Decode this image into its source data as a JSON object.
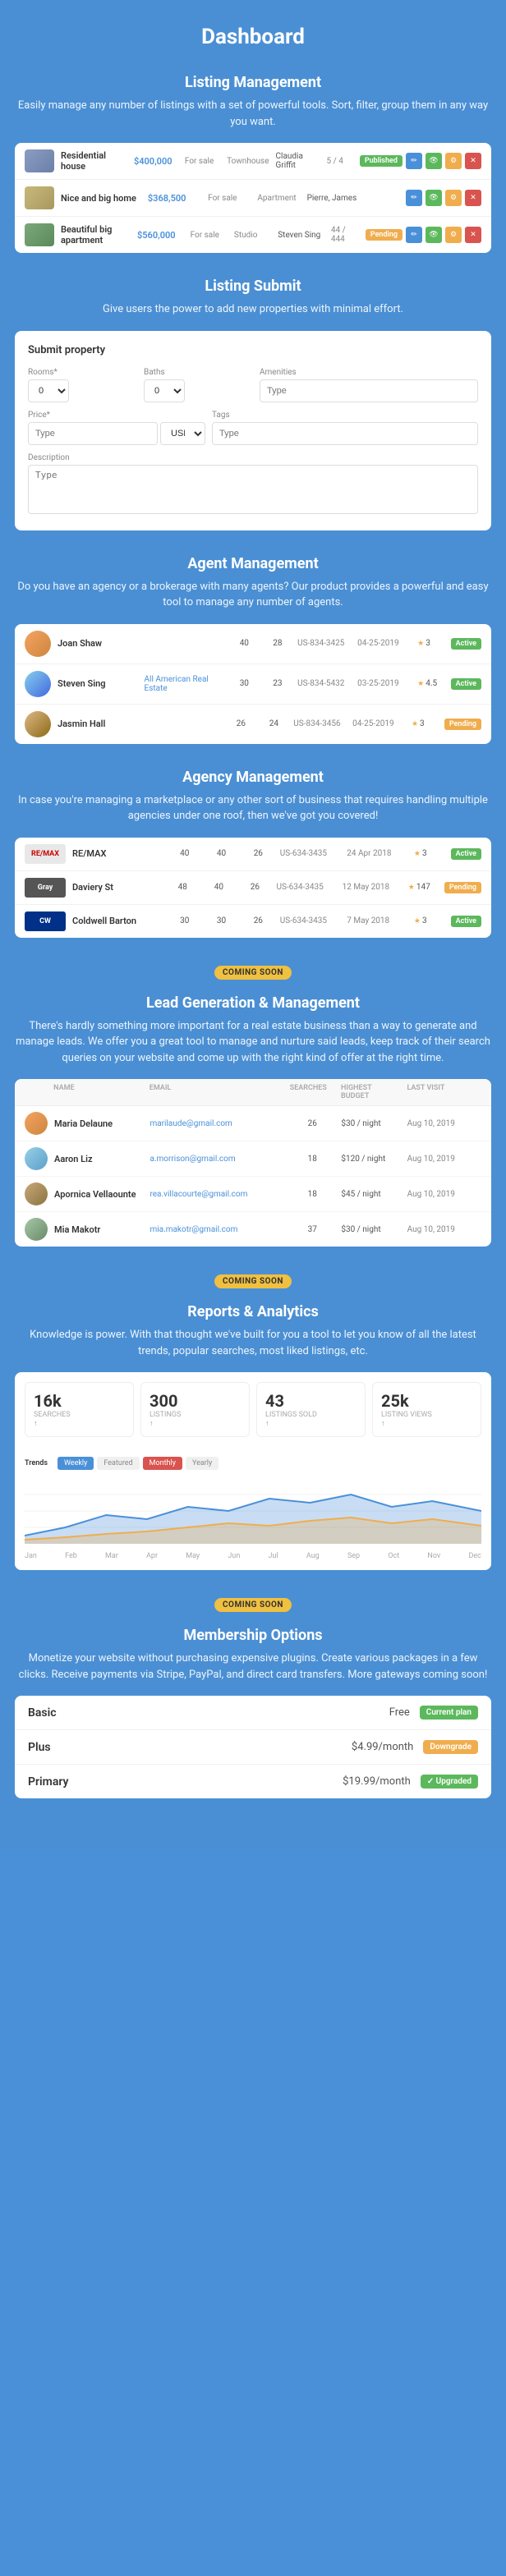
{
  "page": {
    "title": "Dashboard"
  },
  "listing_management": {
    "title": "Listing Management",
    "description": "Easily manage any number of listings with a set of powerful tools. Sort, filter, group them in any way you want.",
    "listings": [
      {
        "name": "Residential house",
        "price": "$400,000",
        "status": "For sale",
        "type": "Townhouse",
        "agent": "Claudia Griffit",
        "beds": "5",
        "baths": "4",
        "badge": "Published",
        "badge_type": "success",
        "thumb_class": "residential"
      },
      {
        "name": "Nice and big home",
        "price": "$368,500",
        "status": "For sale",
        "type": "Apartment",
        "agent": "Pierre, James",
        "beds": "",
        "baths": "",
        "badge": "",
        "badge_type": "",
        "thumb_class": "modern"
      },
      {
        "name": "Beautiful big apartment",
        "price": "$560,000",
        "status": "For sale",
        "type": "Studio",
        "agent": "Steven Sing",
        "beds": "44",
        "baths": "444",
        "badge": "Pending",
        "badge_type": "warning",
        "thumb_class": "apt"
      }
    ]
  },
  "listing_submit": {
    "title": "Listing Submit",
    "description": "Give users the power to add new properties with minimal effort.",
    "form_title": "Submit property",
    "fields": {
      "rooms_label": "Rooms*",
      "rooms_placeholder": "0",
      "baths_label": "Baths",
      "baths_placeholder": "0",
      "amenities_label": "Amenities",
      "amenities_placeholder": "Type",
      "price_label": "Price*",
      "price_placeholder": "Type",
      "price_unit": "USD",
      "tags_label": "Tags",
      "tags_placeholder": "Type",
      "description_label": "Description",
      "description_placeholder": "Type"
    }
  },
  "agent_management": {
    "title": "Agent Management",
    "description": "Do you have an agency or a brokerage with many agents? Our product provides a powerful and easy tool to manage any number of agents.",
    "agents": [
      {
        "name": "Joan Shaw",
        "agency": "",
        "agency_link": "",
        "listings": "40",
        "active": "28",
        "id": "US-834-3425",
        "date": "04-25-2019",
        "rating": "3",
        "badge": "Active",
        "badge_type": "success",
        "avatar_class": "avatar-1"
      },
      {
        "name": "Steven Sing",
        "agency": "All American Real Estate",
        "agency_link": "All American Real Estate",
        "listings": "30",
        "active": "23",
        "id": "US-834-5432",
        "date": "03-25-2019",
        "rating": "4.5",
        "badge": "Active",
        "badge_type": "success",
        "avatar_class": "avatar-2"
      },
      {
        "name": "Jasmin Hall",
        "agency": "",
        "agency_link": "",
        "listings": "26",
        "active": "24",
        "id": "US-834-3456",
        "date": "04-25-2019",
        "rating": "3",
        "badge": "Pending",
        "badge_type": "warning",
        "avatar_class": "avatar-3"
      }
    ]
  },
  "agency_management": {
    "title": "Agency Management",
    "description": "In case you're managing a marketplace or any other sort of business that requires handling multiple agencies under one roof, then we've got you covered!",
    "agencies": [
      {
        "logo_text": "RE/MAX",
        "logo_class": "logo-remax",
        "name": "RE/MAX",
        "sub": "remax",
        "agents": "40",
        "active": "40",
        "listings": "26",
        "id": "US-634-3435",
        "date": "24 Apr 2018",
        "rating": "3",
        "badge": "Active",
        "badge_type": "success"
      },
      {
        "logo_text": "Gray",
        "logo_class": "logo-gray",
        "name": "Daviery St",
        "sub": "",
        "agents": "48",
        "active": "40",
        "listings": "26",
        "id": "US-634-3435",
        "date": "12 May 2018",
        "rating": "147",
        "badge": "Pending",
        "badge_type": "warning"
      },
      {
        "logo_text": "CW",
        "logo_class": "logo-cw",
        "name": "Coldwell Barton",
        "sub": "",
        "agents": "30",
        "active": "30",
        "listings": "26",
        "id": "US-634-3435",
        "date": "7 May 2018",
        "rating": "3",
        "badge": "Active",
        "badge_type": "success"
      }
    ]
  },
  "lead_generation": {
    "coming_soon": "COMING SOON",
    "title": "Lead Generation & Management",
    "description": "There's hardly something more important for a real estate business than a way to generate and manage leads. We offer you a great tool to manage and nurture said leads, keep track of their search queries on your website and come up with the right kind of offer at the right time.",
    "table_headers": [
      "Name",
      "Email",
      "Searches",
      "Highest Budget",
      "Last Visit"
    ],
    "leads": [
      {
        "name": "Maria Delaune",
        "email": "marilaude@gmail.com",
        "searches": "26",
        "budget": "$30 / night",
        "last_visit": "Aug 10, 2019",
        "avatar_class": "la-1"
      },
      {
        "name": "Aaron Liz",
        "email": "a.morrison@gmail.com",
        "searches": "18",
        "budget": "$120 / night",
        "last_visit": "Aug 10, 2019",
        "avatar_class": "la-2"
      },
      {
        "name": "Apornica Vellaounte",
        "email": "rea.villacourte@gmail.com",
        "searches": "18",
        "budget": "$45 / night",
        "last_visit": "Aug 10, 2019",
        "avatar_class": "la-3"
      },
      {
        "name": "Mia Makotr",
        "email": "mia.makotr@gmail.com",
        "searches": "37",
        "budget": "$30 / night",
        "last_visit": "Aug 10, 2019",
        "avatar_class": "la-4"
      }
    ]
  },
  "reports": {
    "coming_soon": "COMING SOON",
    "title": "Reports & Analytics",
    "description": "Knowledge is power. With that thought we've built for you a tool to let you know of all the latest trends, popular searches, most liked listings, etc.",
    "stats": [
      {
        "number": "16k",
        "label": "Searches",
        "change": "↑"
      },
      {
        "number": "300",
        "label": "Listings",
        "change": "↑"
      },
      {
        "number": "43",
        "label": "Listings sold",
        "change": "↑"
      },
      {
        "number": "25k",
        "label": "Listing views",
        "change": "↑"
      }
    ],
    "chart": {
      "label": "Trends",
      "tabs": [
        "Weekly",
        "Featured",
        "Monthly",
        "Yearly"
      ]
    }
  },
  "membership": {
    "coming_soon": "COMING SOON",
    "title": "Membership Options",
    "description": "Monetize your website without purchasing expensive plugins. Create various packages in a few clicks. Receive payments via Stripe, PayPal, and direct card transfers. More gateways coming soon!",
    "plans": [
      {
        "name": "Basic",
        "price": "Free",
        "badge": "Current plan",
        "badge_type": "free-badge"
      },
      {
        "name": "Plus",
        "price": "$4.99/month",
        "badge": "Downgrade",
        "badge_type": "upgrade"
      },
      {
        "name": "Primary",
        "price": "$19.99/month",
        "badge": "✓ Upgraded",
        "badge_type": "upgraded"
      }
    ]
  }
}
